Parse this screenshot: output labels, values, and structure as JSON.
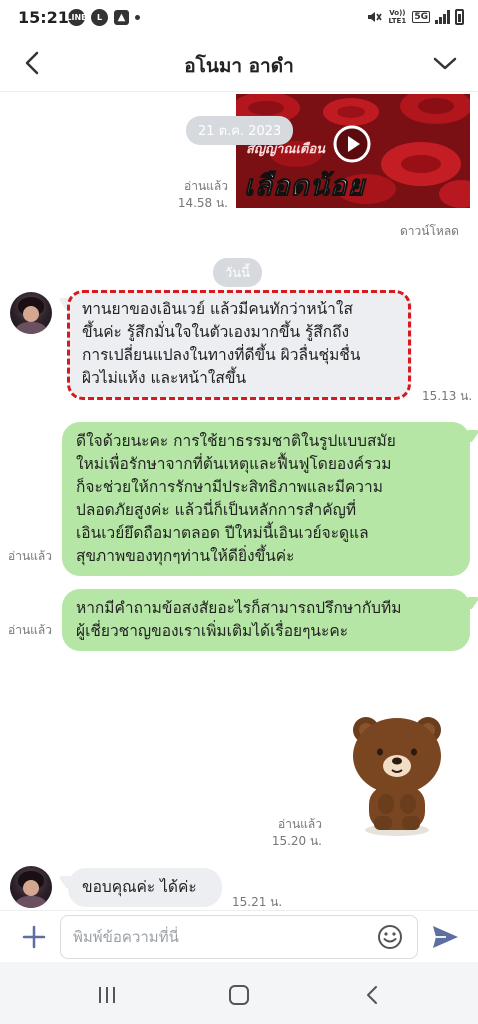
{
  "status_bar": {
    "time": "15:21",
    "app_icons": [
      "line-icon",
      "line-square-icon",
      "gallery-icon",
      "dot"
    ],
    "right_icons": [
      "mute-icon",
      "volte-icon",
      "5g-icon",
      "signal-icon",
      "battery-icon"
    ],
    "volte_label": "Vo)) LTE1",
    "network_label": "5G"
  },
  "header": {
    "title": "อโนมา อาดำ"
  },
  "chat": {
    "video": {
      "overlay_text_top": "สัญญาณเตือน",
      "overlay_text_main": "เลือดน้อย"
    },
    "date_pill": "21 ต.ค. 2023",
    "video_read_label": "อ่านแล้ว",
    "video_time": "14.58 น.",
    "download_label": "ดาวน์โหลด",
    "today_pill": "วันนี้",
    "messages": [
      {
        "from": "customer",
        "text_lines": [
          "ทานยาของเอินเวย์ แล้วมีคนทักว่าหน้าใส",
          "ขึ้นค่ะ รู้สึกมั่นใจในตัวเองมากขึ้น รู้สึกถึง",
          "การเปลี่ยนแปลงในทางที่ดีขึ้น ผิวลื่นชุ่มชื่น",
          "ผิวไม่แห้ง และหน้าใสขึ้น"
        ],
        "time": "15.13 น.",
        "highlighted": true
      },
      {
        "from": "shop",
        "read_label": "อ่านแล้ว",
        "text_lines": [
          "ดีใจด้วยนะคะ การใช้ยาธรรมชาติในรูปแบบสมัย",
          "ใหม่เพื่อรักษาจากที่ต้นเหตุและฟื้นฟูโดยองค์รวม",
          "ก็จะช่วยให้การรักษามีประสิทธิภาพและมีความ",
          "ปลอดภัยสูงค่ะ แล้วนี่ก็เป็นหลักการสำคัญที่",
          "เอินเวย์ยึดถือมาตลอด ปีใหม่นี้เอินเวย์จะดูแล",
          "สุขภาพของทุกๆท่านให้ดียิ่งขึ้นค่ะ"
        ]
      },
      {
        "from": "shop",
        "read_label": "อ่านแล้ว",
        "text_lines": [
          "หากมีคำถามข้อสงสัยอะไรก็สามารถปรึกษากับทีม",
          "ผู้เชี่ยวชาญของเราเพิ่มเติมได้เรื่อยๆนะคะ"
        ]
      },
      {
        "from": "shop",
        "type": "sticker",
        "sticker": "brown-bear",
        "read_label": "อ่านแล้ว",
        "time": "15.20 น."
      },
      {
        "from": "customer",
        "text_lines": [
          "ขอบคุณค่ะ ได้ค่ะ"
        ],
        "time": "15.21 น."
      }
    ]
  },
  "input": {
    "placeholder": "พิมพ์ข้อความที่นี่"
  },
  "colors": {
    "outgoing_bubble": "#b6e6a6",
    "incoming_bubble": "#eceef1",
    "highlight_border": "#d71920",
    "send_accent": "#5c6fa0"
  }
}
